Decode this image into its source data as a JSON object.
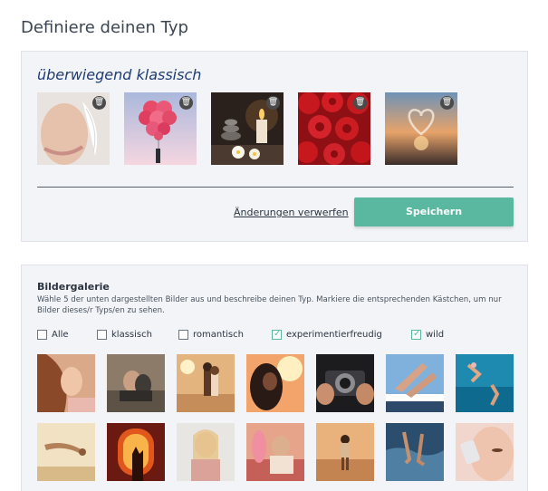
{
  "page": {
    "title": "Definiere deinen Typ"
  },
  "type_panel": {
    "type_name": "überwiegend klassisch",
    "delete_icon": "trash-icon",
    "selected_images": [
      {
        "name": "smiling-woman-feather"
      },
      {
        "name": "heart-balloons"
      },
      {
        "name": "candles-stones-flowers"
      },
      {
        "name": "red-roses"
      },
      {
        "name": "heart-on-window-sunset"
      }
    ],
    "discard_label": "Änderungen verwerfen",
    "save_label": "Speichern"
  },
  "gallery": {
    "title": "Bildergalerie",
    "description": "Wähle 5 der unten dargestellten Bilder aus und beschreibe deinen Typ. Markiere die entsprechenden Kästchen, um nur Bilder dieses/r Typs/en zu sehen.",
    "filters": [
      {
        "label": "Alle",
        "checked": false
      },
      {
        "label": "klassisch",
        "checked": false
      },
      {
        "label": "romantisch",
        "checked": false
      },
      {
        "label": "experimentierfreudig",
        "checked": true
      },
      {
        "label": "wild",
        "checked": true
      }
    ],
    "images": [
      {
        "name": "woman-hair-portrait"
      },
      {
        "name": "couple-sitting"
      },
      {
        "name": "couple-beach-sunset"
      },
      {
        "name": "woman-sunlight"
      },
      {
        "name": "hands-camera"
      },
      {
        "name": "legs-boat-sky"
      },
      {
        "name": "jumping-into-sea"
      },
      {
        "name": "gymnast-beach"
      },
      {
        "name": "hand-airplane-window"
      },
      {
        "name": "blonde-woman-smiling"
      },
      {
        "name": "woman-flamingo-float"
      },
      {
        "name": "woman-desert-walk"
      },
      {
        "name": "feet-water-waves"
      },
      {
        "name": "woman-face-closeup"
      }
    ]
  },
  "colors": {
    "accent": "#5bb8a0",
    "type_name": "#1f3b73",
    "panel_bg": "#f2f4f7"
  }
}
